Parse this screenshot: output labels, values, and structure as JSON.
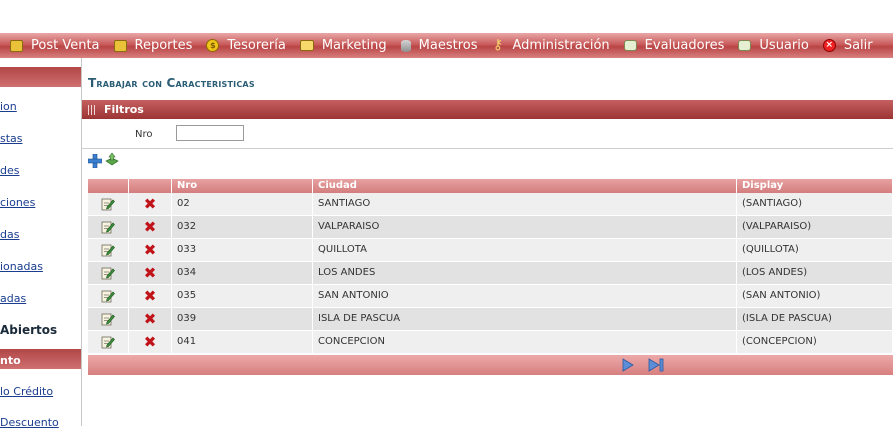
{
  "menu": [
    {
      "label": "Post Venta",
      "icon": "folder-icon"
    },
    {
      "label": "Reportes",
      "icon": "folder-icon"
    },
    {
      "label": "Tesorería",
      "icon": "coin-icon"
    },
    {
      "label": "Marketing",
      "icon": "card-icon"
    },
    {
      "label": "Maestros",
      "icon": "database-icon"
    },
    {
      "label": "Administración",
      "icon": "key-icon"
    },
    {
      "label": "Evaluadores",
      "icon": "evaluator-icon"
    },
    {
      "label": "Usuario",
      "icon": "user-card-icon"
    },
    {
      "label": "Salir",
      "icon": "exit-icon"
    }
  ],
  "sidebar": {
    "links": [
      "ion",
      "stas",
      "des",
      "ciones",
      "das",
      "ionadas",
      "adas"
    ],
    "static_label": "Abiertos",
    "section_header": "nto",
    "links2": [
      "lo Crédito",
      "Descuento"
    ]
  },
  "page": {
    "title": "Trabajar con Caracteristicas"
  },
  "filters": {
    "header": "Filtros",
    "nro_label": "Nro",
    "nro_value": ""
  },
  "grid": {
    "columns": [
      "",
      "",
      "Nro",
      "Ciudad",
      "Display"
    ],
    "rows": [
      {
        "nro": "02",
        "ciudad": "SANTIAGO",
        "display": "(SANTIAGO)"
      },
      {
        "nro": "032",
        "ciudad": "VALPARAISO",
        "display": "(VALPARAISO)"
      },
      {
        "nro": "033",
        "ciudad": "QUILLOTA",
        "display": "(QUILLOTA)"
      },
      {
        "nro": "034",
        "ciudad": "LOS ANDES",
        "display": "(LOS ANDES)"
      },
      {
        "nro": "035",
        "ciudad": "SAN ANTONIO",
        "display": "(SAN ANTONIO)"
      },
      {
        "nro": "039",
        "ciudad": "ISLA DE PASCUA",
        "display": "(ISLA DE PASCUA)"
      },
      {
        "nro": "041",
        "ciudad": "CONCEPCION",
        "display": "(CONCEPCION)"
      }
    ]
  },
  "colors": {
    "menu_bar": "#c95c5c",
    "title": "#2b5d75",
    "link": "#1a3d8f",
    "delete": "#c0141a"
  }
}
